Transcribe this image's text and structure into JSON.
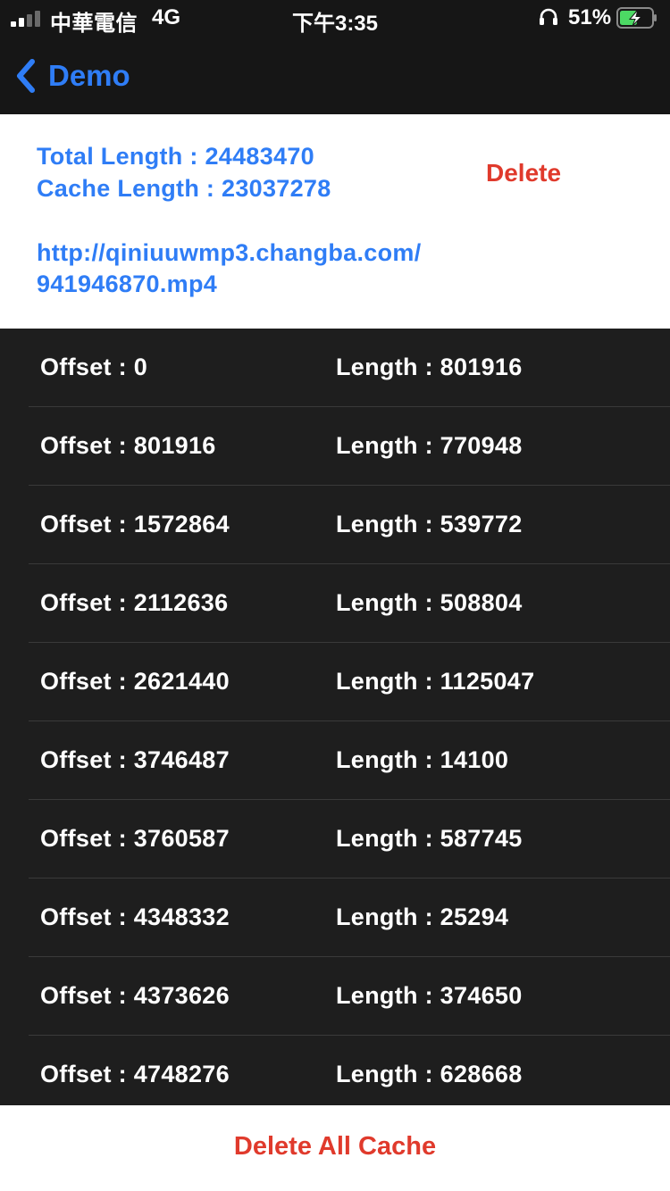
{
  "status_bar": {
    "carrier": "中華電信",
    "network": "4G",
    "time": "下午3:35",
    "battery_percent": "51%",
    "signal_bars_total": 4,
    "signal_bars_filled": 2
  },
  "nav": {
    "back_label": "Demo"
  },
  "info": {
    "total_length": "Total Length : 24483470",
    "cache_length": "Cache Length : 23037278",
    "url_line1": "http://qiniuuwmp3.changba.com/",
    "url_line2": "941946870.mp4",
    "delete_label": "Delete"
  },
  "segments": [
    {
      "offset": "Offset : 0",
      "length": "Length : 801916"
    },
    {
      "offset": "Offset : 801916",
      "length": "Length : 770948"
    },
    {
      "offset": "Offset : 1572864",
      "length": "Length : 539772"
    },
    {
      "offset": "Offset : 2112636",
      "length": "Length : 508804"
    },
    {
      "offset": "Offset : 2621440",
      "length": "Length : 1125047"
    },
    {
      "offset": "Offset : 3746487",
      "length": "Length : 14100"
    },
    {
      "offset": "Offset : 3760587",
      "length": "Length : 587745"
    },
    {
      "offset": "Offset : 4348332",
      "length": "Length : 25294"
    },
    {
      "offset": "Offset : 4373626",
      "length": "Length : 374650"
    },
    {
      "offset": "Offset : 4748276",
      "length": "Length : 628668"
    }
  ],
  "bottom": {
    "delete_all_label": "Delete All Cache"
  },
  "colors": {
    "accent_blue": "#2f7df6",
    "destructive_red": "#e03a2c",
    "list_background": "#1e1e1e",
    "bar_background": "#161616",
    "battery_green": "#4cd964"
  },
  "icons": {
    "back": "chevron-left-icon",
    "headphones": "headphones-icon",
    "battery": "battery-charging-icon",
    "signal": "cellular-signal-icon"
  }
}
